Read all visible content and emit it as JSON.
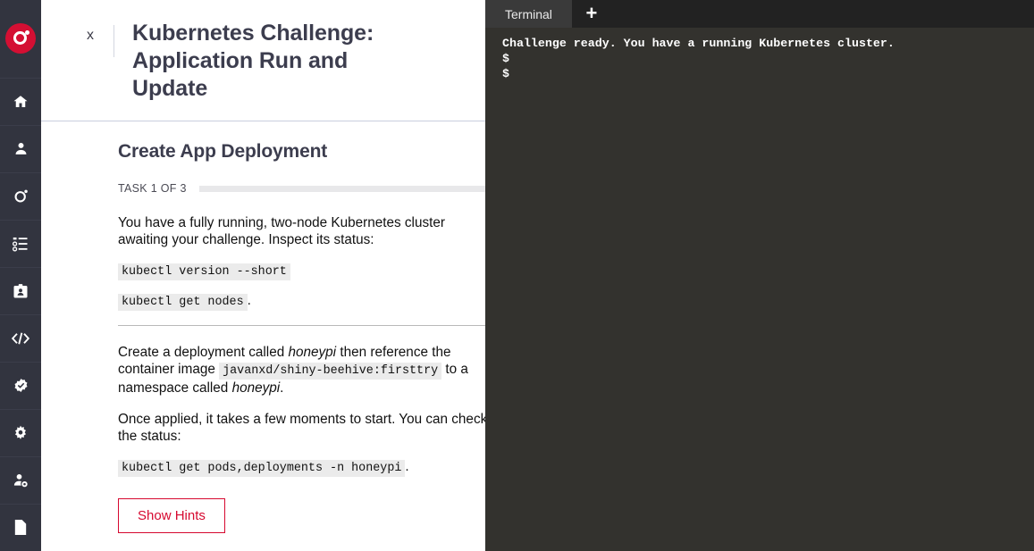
{
  "sidebar": {
    "logo": {
      "name": "app-logo"
    },
    "items": [
      {
        "icon": "home-icon"
      },
      {
        "icon": "user-icon"
      },
      {
        "icon": "openshift-ring-icon"
      },
      {
        "icon": "list-check-icon"
      },
      {
        "icon": "id-badge-icon"
      },
      {
        "icon": "code-icon"
      },
      {
        "icon": "check-badge-icon"
      },
      {
        "icon": "gear-icon"
      },
      {
        "icon": "user-gear-icon"
      },
      {
        "icon": "file-icon"
      }
    ]
  },
  "panel": {
    "close_label": "x",
    "title": "Kubernetes Challenge: Application Run and Update",
    "section_title": "Create App Deployment",
    "task_label": "TASK 1 OF 3",
    "progress_percent": 0,
    "paragraph_1": "You have a fully running, two-node Kubernetes cluster awaiting your challenge. Inspect its status:",
    "code_1": "kubectl version --short",
    "code_2": "kubectl get nodes",
    "code_2_suffix": ".",
    "paragraph_2_part1": "Create a deployment called ",
    "paragraph_2_em1": "honeypi",
    "paragraph_2_part2": " then reference the container image ",
    "paragraph_2_code": "javanxd/shiny-beehive:firsttry",
    "paragraph_2_part3": " to a namespace called ",
    "paragraph_2_em2": "honeypi",
    "paragraph_2_part4": ".",
    "paragraph_3": "Once applied, it takes a few moments to start. You can check the status:",
    "code_3": "kubectl get pods,deployments -n honeypi",
    "code_3_suffix": ".",
    "hints_button": "Show Hints"
  },
  "terminal": {
    "tab_label": "Terminal",
    "add_tab_label": "+",
    "output": "Challenge ready. You have a running Kubernetes cluster.\n$\n$"
  },
  "colors": {
    "sidebar_bg": "#32343f",
    "logo_red": "#d40f33",
    "accent_red": "#d6082f",
    "terminal_bg": "#33322e",
    "tabbar_bg": "#222222",
    "tab_active_bg": "#3a3a3a",
    "code_bg": "#ebebeb",
    "title_color": "#3c3d4e"
  }
}
